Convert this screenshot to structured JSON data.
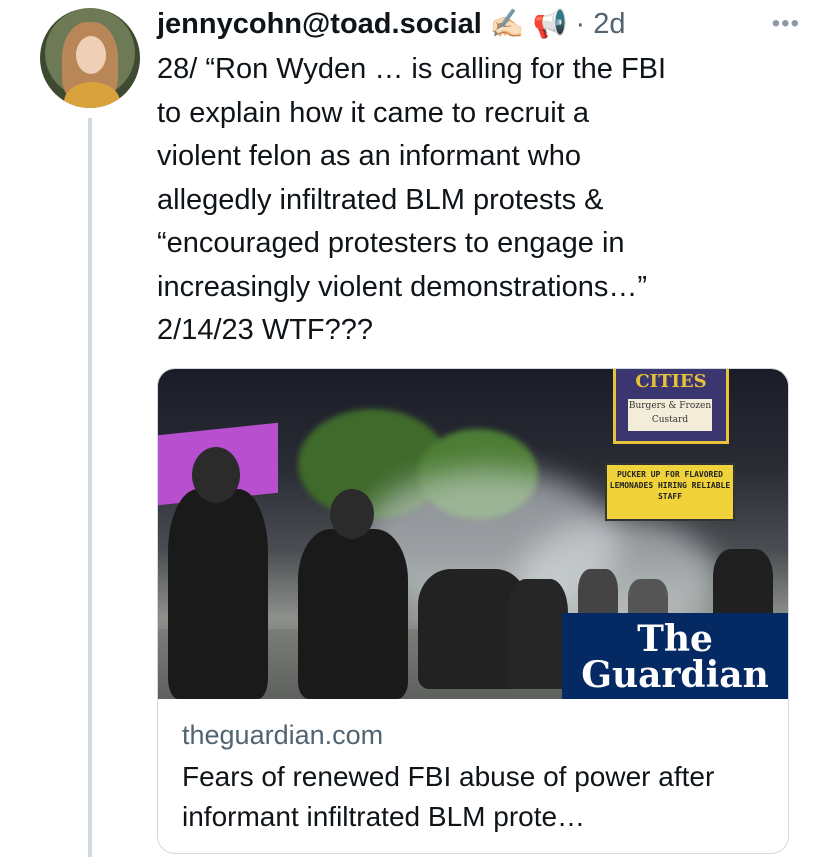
{
  "tweet": {
    "handle": "jennycohn@toad.social",
    "emoji_1": "✍🏻",
    "emoji_2": "📢",
    "separator": "·",
    "time": "2d",
    "more": "•••",
    "text": "28/ “Ron Wyden … is calling for the FBI\nto explain how it came to recruit a\nviolent felon as an informant who\nallegedly infiltrated BLM protests &\n“encouraged protesters to engage in\nincreasingly violent demonstrations…”\n2/14/23 WTF???"
  },
  "card": {
    "image_signs": {
      "top_sign": "CITIES",
      "top_sign_sub": "Burgers & Frozen Custard",
      "yellow_sign": "PUCKER UP FOR FLAVORED LEMONADES HIRING RELIABLE STAFF"
    },
    "logo_line_1": "The",
    "logo_line_2": "Guardian",
    "domain": "theguardian.com",
    "title": "Fears of renewed FBI abuse of power after informant infiltrated BLM prote…"
  },
  "colors": {
    "text": "#0f1419",
    "secondary": "#536471",
    "border": "#cfd9de",
    "guardian_blue": "#052962"
  }
}
